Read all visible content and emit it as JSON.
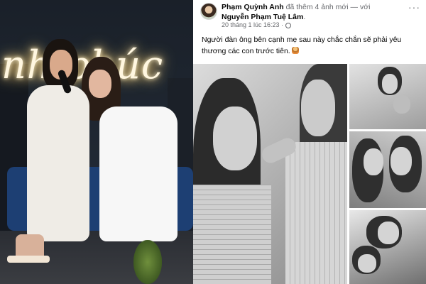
{
  "post": {
    "author": "Phạm Quỳnh Anh",
    "action_text": " đã thêm 4 ảnh mới — với ",
    "tagged": "Nguyễn Phạm Tuệ Lâm",
    "period": ".",
    "timestamp": "20 tháng 1 lúc 16:23 ·",
    "more_label": "···",
    "caption": "Người đàn ông bên cạnh mẹ sau này chắc chắn sẽ phải yêu thương các con trước tiên."
  },
  "stage_photo": {
    "neon_sign": "nh phúc"
  },
  "icons": {
    "globe": "globe-icon",
    "emoji": "person-emoji-icon",
    "more": "more-icon"
  },
  "colors": {
    "name_text": "#050505",
    "meta_text": "#65676b",
    "neon_glow": "#ffd98a",
    "sofa": "#1d3f73"
  }
}
